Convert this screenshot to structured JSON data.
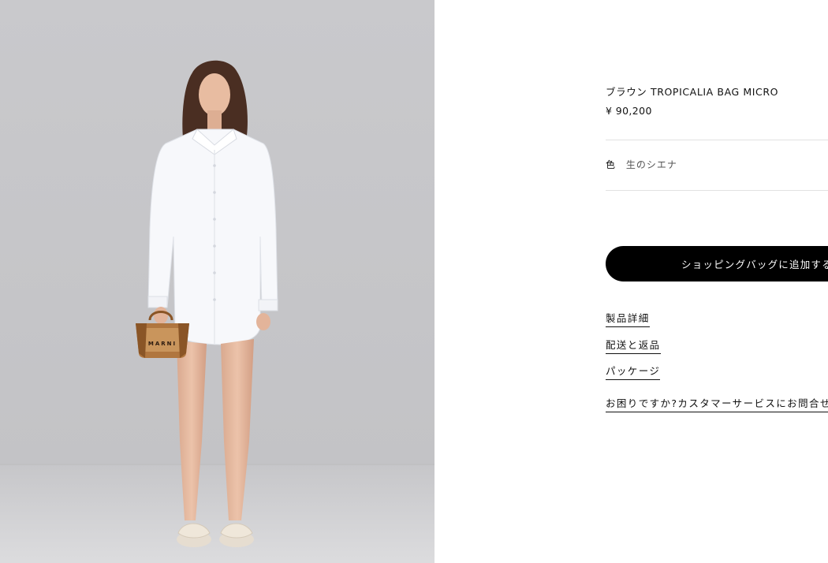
{
  "product": {
    "image_alt": "Model wearing white shirt holding brown woven micro bag",
    "title": "ブラウン TROPICALIA BAG MICRO",
    "price": "¥ 90,200",
    "color_label": "色",
    "color_value": "生のシエナ"
  },
  "actions": {
    "add_to_bag": "ショッピングバッグに追加する"
  },
  "links": {
    "details": "製品詳細",
    "shipping": "配送と返品",
    "packaging": "パッケージ",
    "help": "お困りですか?カスタマーサービスにお問合せく"
  },
  "bag_logo": "MARNI",
  "colors": {
    "backdrop": "#cbcbcd",
    "floor": "#d8d8da",
    "button": "#000000",
    "shirt": "#f7f8fb",
    "bag": "#b0763f"
  }
}
